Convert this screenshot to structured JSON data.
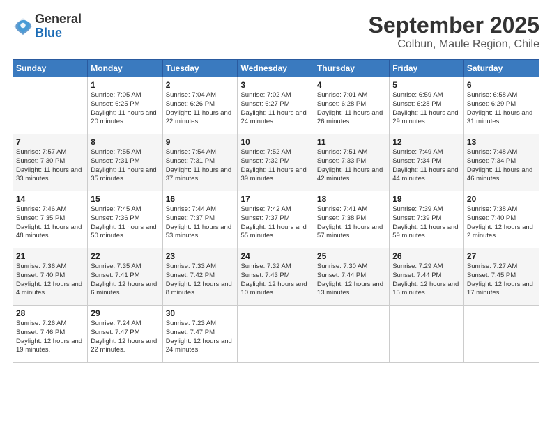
{
  "header": {
    "logo_general": "General",
    "logo_blue": "Blue",
    "month": "September 2025",
    "location": "Colbun, Maule Region, Chile"
  },
  "days_of_week": [
    "Sunday",
    "Monday",
    "Tuesday",
    "Wednesday",
    "Thursday",
    "Friday",
    "Saturday"
  ],
  "weeks": [
    [
      {
        "day": "",
        "sunrise": "",
        "sunset": "",
        "daylight": ""
      },
      {
        "day": "1",
        "sunrise": "Sunrise: 7:05 AM",
        "sunset": "Sunset: 6:25 PM",
        "daylight": "Daylight: 11 hours and 20 minutes."
      },
      {
        "day": "2",
        "sunrise": "Sunrise: 7:04 AM",
        "sunset": "Sunset: 6:26 PM",
        "daylight": "Daylight: 11 hours and 22 minutes."
      },
      {
        "day": "3",
        "sunrise": "Sunrise: 7:02 AM",
        "sunset": "Sunset: 6:27 PM",
        "daylight": "Daylight: 11 hours and 24 minutes."
      },
      {
        "day": "4",
        "sunrise": "Sunrise: 7:01 AM",
        "sunset": "Sunset: 6:28 PM",
        "daylight": "Daylight: 11 hours and 26 minutes."
      },
      {
        "day": "5",
        "sunrise": "Sunrise: 6:59 AM",
        "sunset": "Sunset: 6:28 PM",
        "daylight": "Daylight: 11 hours and 29 minutes."
      },
      {
        "day": "6",
        "sunrise": "Sunrise: 6:58 AM",
        "sunset": "Sunset: 6:29 PM",
        "daylight": "Daylight: 11 hours and 31 minutes."
      }
    ],
    [
      {
        "day": "7",
        "sunrise": "Sunrise: 7:57 AM",
        "sunset": "Sunset: 7:30 PM",
        "daylight": "Daylight: 11 hours and 33 minutes."
      },
      {
        "day": "8",
        "sunrise": "Sunrise: 7:55 AM",
        "sunset": "Sunset: 7:31 PM",
        "daylight": "Daylight: 11 hours and 35 minutes."
      },
      {
        "day": "9",
        "sunrise": "Sunrise: 7:54 AM",
        "sunset": "Sunset: 7:31 PM",
        "daylight": "Daylight: 11 hours and 37 minutes."
      },
      {
        "day": "10",
        "sunrise": "Sunrise: 7:52 AM",
        "sunset": "Sunset: 7:32 PM",
        "daylight": "Daylight: 11 hours and 39 minutes."
      },
      {
        "day": "11",
        "sunrise": "Sunrise: 7:51 AM",
        "sunset": "Sunset: 7:33 PM",
        "daylight": "Daylight: 11 hours and 42 minutes."
      },
      {
        "day": "12",
        "sunrise": "Sunrise: 7:49 AM",
        "sunset": "Sunset: 7:34 PM",
        "daylight": "Daylight: 11 hours and 44 minutes."
      },
      {
        "day": "13",
        "sunrise": "Sunrise: 7:48 AM",
        "sunset": "Sunset: 7:34 PM",
        "daylight": "Daylight: 11 hours and 46 minutes."
      }
    ],
    [
      {
        "day": "14",
        "sunrise": "Sunrise: 7:46 AM",
        "sunset": "Sunset: 7:35 PM",
        "daylight": "Daylight: 11 hours and 48 minutes."
      },
      {
        "day": "15",
        "sunrise": "Sunrise: 7:45 AM",
        "sunset": "Sunset: 7:36 PM",
        "daylight": "Daylight: 11 hours and 50 minutes."
      },
      {
        "day": "16",
        "sunrise": "Sunrise: 7:44 AM",
        "sunset": "Sunset: 7:37 PM",
        "daylight": "Daylight: 11 hours and 53 minutes."
      },
      {
        "day": "17",
        "sunrise": "Sunrise: 7:42 AM",
        "sunset": "Sunset: 7:37 PM",
        "daylight": "Daylight: 11 hours and 55 minutes."
      },
      {
        "day": "18",
        "sunrise": "Sunrise: 7:41 AM",
        "sunset": "Sunset: 7:38 PM",
        "daylight": "Daylight: 11 hours and 57 minutes."
      },
      {
        "day": "19",
        "sunrise": "Sunrise: 7:39 AM",
        "sunset": "Sunset: 7:39 PM",
        "daylight": "Daylight: 11 hours and 59 minutes."
      },
      {
        "day": "20",
        "sunrise": "Sunrise: 7:38 AM",
        "sunset": "Sunset: 7:40 PM",
        "daylight": "Daylight: 12 hours and 2 minutes."
      }
    ],
    [
      {
        "day": "21",
        "sunrise": "Sunrise: 7:36 AM",
        "sunset": "Sunset: 7:40 PM",
        "daylight": "Daylight: 12 hours and 4 minutes."
      },
      {
        "day": "22",
        "sunrise": "Sunrise: 7:35 AM",
        "sunset": "Sunset: 7:41 PM",
        "daylight": "Daylight: 12 hours and 6 minutes."
      },
      {
        "day": "23",
        "sunrise": "Sunrise: 7:33 AM",
        "sunset": "Sunset: 7:42 PM",
        "daylight": "Daylight: 12 hours and 8 minutes."
      },
      {
        "day": "24",
        "sunrise": "Sunrise: 7:32 AM",
        "sunset": "Sunset: 7:43 PM",
        "daylight": "Daylight: 12 hours and 10 minutes."
      },
      {
        "day": "25",
        "sunrise": "Sunrise: 7:30 AM",
        "sunset": "Sunset: 7:44 PM",
        "daylight": "Daylight: 12 hours and 13 minutes."
      },
      {
        "day": "26",
        "sunrise": "Sunrise: 7:29 AM",
        "sunset": "Sunset: 7:44 PM",
        "daylight": "Daylight: 12 hours and 15 minutes."
      },
      {
        "day": "27",
        "sunrise": "Sunrise: 7:27 AM",
        "sunset": "Sunset: 7:45 PM",
        "daylight": "Daylight: 12 hours and 17 minutes."
      }
    ],
    [
      {
        "day": "28",
        "sunrise": "Sunrise: 7:26 AM",
        "sunset": "Sunset: 7:46 PM",
        "daylight": "Daylight: 12 hours and 19 minutes."
      },
      {
        "day": "29",
        "sunrise": "Sunrise: 7:24 AM",
        "sunset": "Sunset: 7:47 PM",
        "daylight": "Daylight: 12 hours and 22 minutes."
      },
      {
        "day": "30",
        "sunrise": "Sunrise: 7:23 AM",
        "sunset": "Sunset: 7:47 PM",
        "daylight": "Daylight: 12 hours and 24 minutes."
      },
      {
        "day": "",
        "sunrise": "",
        "sunset": "",
        "daylight": ""
      },
      {
        "day": "",
        "sunrise": "",
        "sunset": "",
        "daylight": ""
      },
      {
        "day": "",
        "sunrise": "",
        "sunset": "",
        "daylight": ""
      },
      {
        "day": "",
        "sunrise": "",
        "sunset": "",
        "daylight": ""
      }
    ]
  ]
}
